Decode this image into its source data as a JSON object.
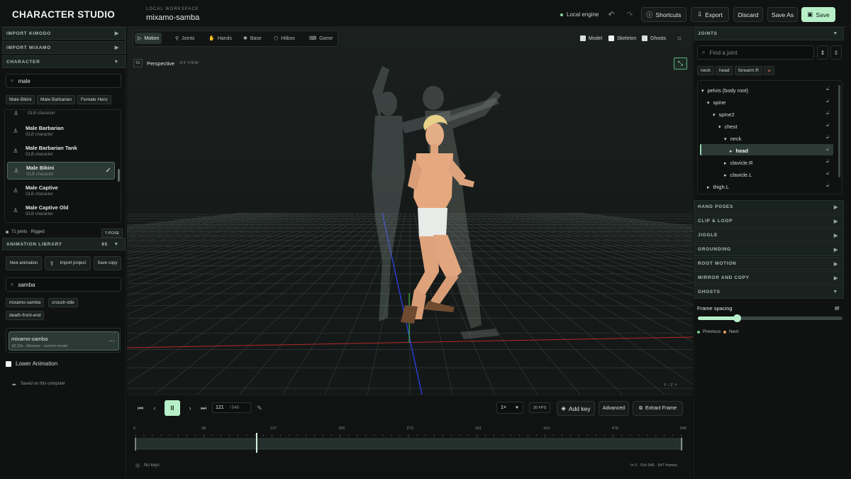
{
  "brand": "CHARACTER STUDIO",
  "workspace": {
    "label": "LOCAL WORKSPACE",
    "name": "mixamo-samba"
  },
  "topbar": {
    "engine": "Local engine",
    "shortcuts": "Shortcuts",
    "export": "Export",
    "discard": "Discard",
    "save_as": "Save As",
    "save": "Save"
  },
  "left": {
    "import_kimodo": "IMPORT KIMODO",
    "import_mixamo": "IMPORT MIXAMO",
    "character": "CHARACTER",
    "char_search": "male",
    "char_chips": [
      "Male Bikini",
      "Male Barbarian",
      "Female Hero"
    ],
    "char_cut": "GLB character",
    "characters": [
      {
        "name": "Male Barbarian",
        "sub": "GLB character"
      },
      {
        "name": "Male Barbarian Tank",
        "sub": "GLB character"
      },
      {
        "name": "Male Bikini",
        "sub": "GLB character"
      },
      {
        "name": "Male Captive",
        "sub": "GLB character"
      },
      {
        "name": "Male Captive Old",
        "sub": "GLB character"
      }
    ],
    "joints_info": "71 joints · Rigged",
    "tpose": "T-POSE",
    "anim_library": "ANIMATION LIBRARY",
    "anim_count": "85",
    "new_animation": "New animation",
    "import_project": "Import project",
    "save_copy": "Save copy",
    "anim_search": "samba",
    "anim_chips": [
      "mixamo-samba",
      "crouch-idle",
      "death-front-end"
    ],
    "current_anim": {
      "name": "mixamo-samba",
      "sub": "18.20s · Mixamo · current model"
    },
    "lower_animation": "Lower Animation",
    "saved": "Saved on this computer"
  },
  "viewport": {
    "tabs": [
      "Motion",
      "Joints",
      "Hands",
      "Base",
      "Hitbox",
      "Game"
    ],
    "toggles": [
      "Model",
      "Skeleton",
      "Ghosts"
    ],
    "view_num": "01",
    "view_name": "Perspective",
    "view_sub": "3/4 VIEW",
    "axis": "Y ↑  Z ↗"
  },
  "timeline": {
    "frame": "121",
    "total": "/ 546",
    "speed": "1×",
    "fps": "30 FPS",
    "add_key": "Add key",
    "advanced": "Advanced",
    "extract": "Extract Frame",
    "ticks": [
      "0",
      "68",
      "137",
      "205",
      "273",
      "341",
      "410",
      "478",
      "546"
    ],
    "playhead": 0.222,
    "no_keys": "No keys",
    "range": "In 0 · Out 546 · 547 frames"
  },
  "right": {
    "joints_head": "JOINTS",
    "find": "Find a joint",
    "chips": [
      "neck",
      "head",
      "forearm.R"
    ],
    "tree": [
      {
        "label": "pelvis (body root)",
        "level": 0,
        "open": true
      },
      {
        "label": "spine",
        "level": 1,
        "open": true
      },
      {
        "label": "spine2",
        "level": 2,
        "open": true
      },
      {
        "label": "chest",
        "level": 3,
        "open": true
      },
      {
        "label": "neck",
        "level": 4,
        "open": true
      },
      {
        "label": "head",
        "level": 5,
        "open": false,
        "selected": true
      },
      {
        "label": "clavicle.R",
        "level": 4,
        "open": false
      },
      {
        "label": "clavicle.L",
        "level": 4,
        "open": false
      },
      {
        "label": "thigh.L",
        "level": 1,
        "open": false
      }
    ],
    "sections": [
      "HAND POSES",
      "CLIP & LOOP",
      "JIGGLE",
      "GROUNDING",
      "ROOT MOTION",
      "MIRROR AND COPY"
    ],
    "ghosts": "GHOSTS",
    "frame_spacing": "Frame spacing",
    "frame_spacing_val": "8f",
    "slider": 0.27,
    "previous": "Previous",
    "next": "Next"
  }
}
